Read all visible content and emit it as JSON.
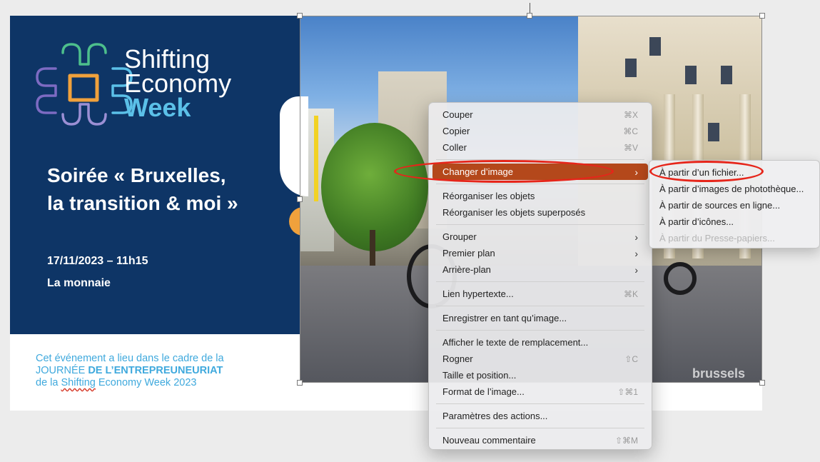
{
  "slide": {
    "logo_line1": "Shifting",
    "logo_line2": "Economy",
    "logo_line3": "Week",
    "title_line1": "Soirée « Bruxelles,",
    "title_line2": "la transition & moi »",
    "date": "17/11/2023 – 11h15",
    "place": "La monnaie",
    "footer_line1": "Cet événement a lieu dans le cadre de la",
    "footer_line2a": "JOURNÉE ",
    "footer_line2b": "DE L’ENTREPREUNEURIAT",
    "footer_line3a": "de la ",
    "footer_line3b": "Shifting",
    "footer_line3c": " Economy Week 2023",
    "photo_watermark": "brussels",
    "colors": {
      "panel": "#0e3566",
      "accent": "#5bc0e8",
      "footer": "#3fa9dd",
      "menu_highlight": "#b4481b",
      "annotation": "#e6251a"
    }
  },
  "context_menu": {
    "cut": "Couper",
    "cut_sc": "⌘X",
    "copy": "Copier",
    "copy_sc": "⌘C",
    "paste": "Coller",
    "paste_sc": "⌘V",
    "change_image": "Changer d’image",
    "reorganize": "Réorganiser les objets",
    "reorganize_overlap": "Réorganiser les objets superposés",
    "group": "Grouper",
    "bring_front": "Premier plan",
    "send_back": "Arrière-plan",
    "hyperlink": "Lien hypertexte...",
    "hyperlink_sc": "⌘K",
    "save_as_image": "Enregistrer en tant qu’image...",
    "alt_text": "Afficher le texte de remplacement...",
    "crop": "Rogner",
    "crop_sc": "⇧C",
    "size_position": "Taille et position...",
    "format_image": "Format de l’image...",
    "format_sc": "⇧⌘1",
    "action_settings": "Paramètres des actions...",
    "new_comment": "Nouveau commentaire",
    "comment_sc": "⇧⌘M"
  },
  "submenu": {
    "from_file": "À partir d’un fichier...",
    "from_stock": "À partir d’images de photothèque...",
    "from_online": "À partir de sources en ligne...",
    "from_icons": "À partir d’icônes...",
    "from_clipboard": "À partir du Presse-papiers..."
  }
}
